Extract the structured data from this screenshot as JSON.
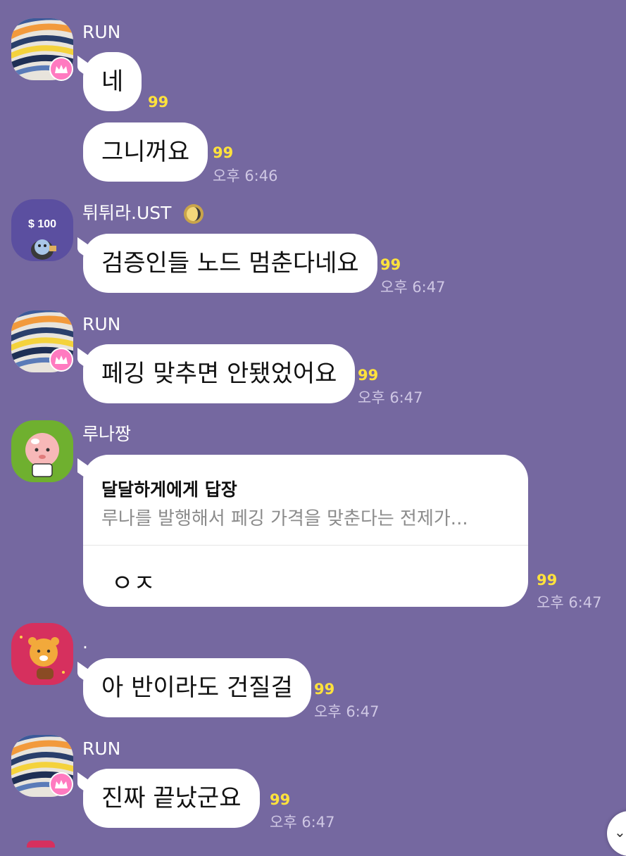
{
  "colors": {
    "background": "#7568a0",
    "bubble": "#ffffff",
    "unread": "#ffe23c",
    "time": "#cfc7e4",
    "crown_badge": "#ff7ac0"
  },
  "messages": [
    {
      "sender": "RUN",
      "avatar": "run-avatar",
      "bubbles": [
        {
          "text": "네",
          "unread": "99"
        },
        {
          "text": "그니꺼요",
          "unread": "99",
          "time": "오후 6:46"
        }
      ]
    },
    {
      "sender": "튀튀라.UST",
      "avatar": "dollar-avatar",
      "avatar_label": "$ 100",
      "sender_icon": "gold-coin-icon",
      "bubbles": [
        {
          "text": "검증인들 노드 멈춘다네요",
          "unread": "99",
          "time": "오후 6:47"
        }
      ]
    },
    {
      "sender": "RUN",
      "avatar": "run-avatar",
      "bubbles": [
        {
          "text": "페깅 맞추면 안됐었어요",
          "unread": "99",
          "time": "오후 6:47"
        }
      ]
    },
    {
      "sender": "루나짱",
      "avatar": "peach-character-avatar",
      "reply": {
        "title": "달달하게에게 답장",
        "quote": "루나를 발행해서 페깅 가격을 맞춘다는 전제가...",
        "text": "ㅇㅈ"
      },
      "unread": "99",
      "time": "오후 6:47"
    },
    {
      "sender": ".",
      "avatar": "lion-character-avatar",
      "bubbles": [
        {
          "text": "아 반이라도 건질걸",
          "unread": "99",
          "time": "오후 6:47"
        }
      ]
    },
    {
      "sender": "RUN",
      "avatar": "run-avatar",
      "bubbles": [
        {
          "text": "진짜 끝났군요",
          "unread": "99",
          "time": "오후 6:47"
        }
      ]
    }
  ]
}
